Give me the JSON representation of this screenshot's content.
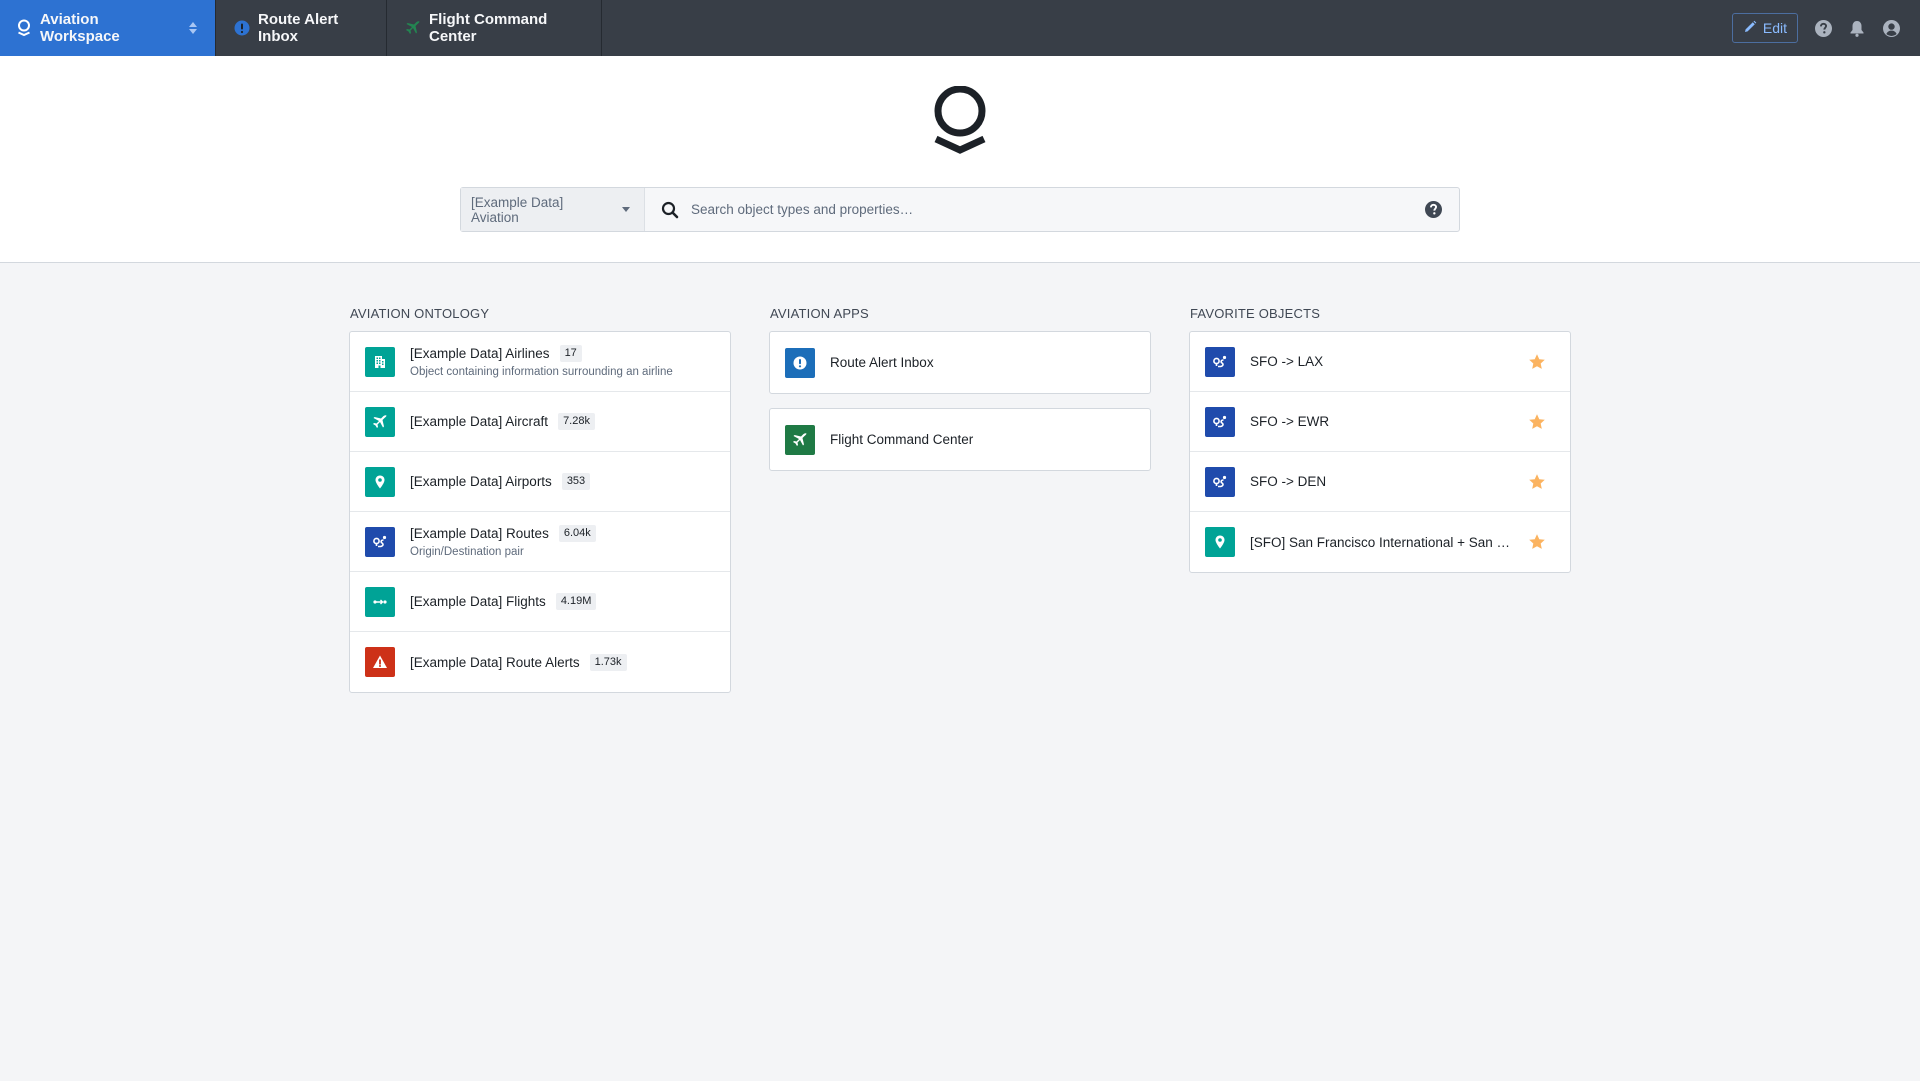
{
  "topbar": {
    "workspace_label": "Aviation Workspace",
    "tabs": [
      {
        "label": "Route Alert Inbox",
        "icon": "alert-circle-icon",
        "icon_color": "#2d72d2"
      },
      {
        "label": "Flight Command Center",
        "icon": "airplane-icon",
        "icon_color": "#238551"
      }
    ],
    "edit_label": "Edit",
    "colors": {
      "bar": "#383e47",
      "workspace": "#2d72d2",
      "edit": "#8abbff"
    }
  },
  "search": {
    "scope_label": "[Example Data] Aviation",
    "placeholder": "Search object types and properties…"
  },
  "ontology": {
    "title": "AVIATION ONTOLOGY",
    "items": [
      {
        "title": "[Example Data] Airlines",
        "count": "17",
        "subtitle": "Object containing information surrounding an airline",
        "icon": "building-icon",
        "color": "#00a396"
      },
      {
        "title": "[Example Data] Aircraft",
        "count": "7.28k",
        "subtitle": "",
        "icon": "airplane-icon",
        "color": "#00a396"
      },
      {
        "title": "[Example Data] Airports",
        "count": "353",
        "subtitle": "",
        "icon": "map-marker-icon",
        "color": "#00a396"
      },
      {
        "title": "[Example Data] Routes",
        "count": "6.04k",
        "subtitle": "Origin/Destination pair",
        "icon": "route-icon",
        "color": "#1f4bac"
      },
      {
        "title": "[Example Data] Flights",
        "count": "4.19M",
        "subtitle": "",
        "icon": "flow-icon",
        "color": "#00a396"
      },
      {
        "title": "[Example Data] Route Alerts",
        "count": "1.73k",
        "subtitle": "",
        "icon": "warning-icon",
        "color": "#cd3118"
      }
    ]
  },
  "apps": {
    "title": "AVIATION APPS",
    "items": [
      {
        "title": "Route Alert Inbox",
        "icon": "alert-circle-icon",
        "color": "#1c6eb9"
      },
      {
        "title": "Flight Command Center",
        "icon": "airplane-icon",
        "color": "#1f7a45"
      }
    ]
  },
  "favorites": {
    "title": "FAVORITE OBJECTS",
    "star_color": "#fbb360",
    "items": [
      {
        "title": "SFO -> LAX",
        "icon": "route-icon",
        "color": "#1f4bac"
      },
      {
        "title": "SFO -> EWR",
        "icon": "route-icon",
        "color": "#1f4bac"
      },
      {
        "title": "SFO -> DEN",
        "icon": "route-icon",
        "color": "#1f4bac"
      },
      {
        "title": "[SFO] San Francisco International + San Francisco, CA",
        "display_title": "[SFO] San Francisco International + San Fra…",
        "icon": "map-marker-icon",
        "color": "#00a396"
      }
    ]
  }
}
